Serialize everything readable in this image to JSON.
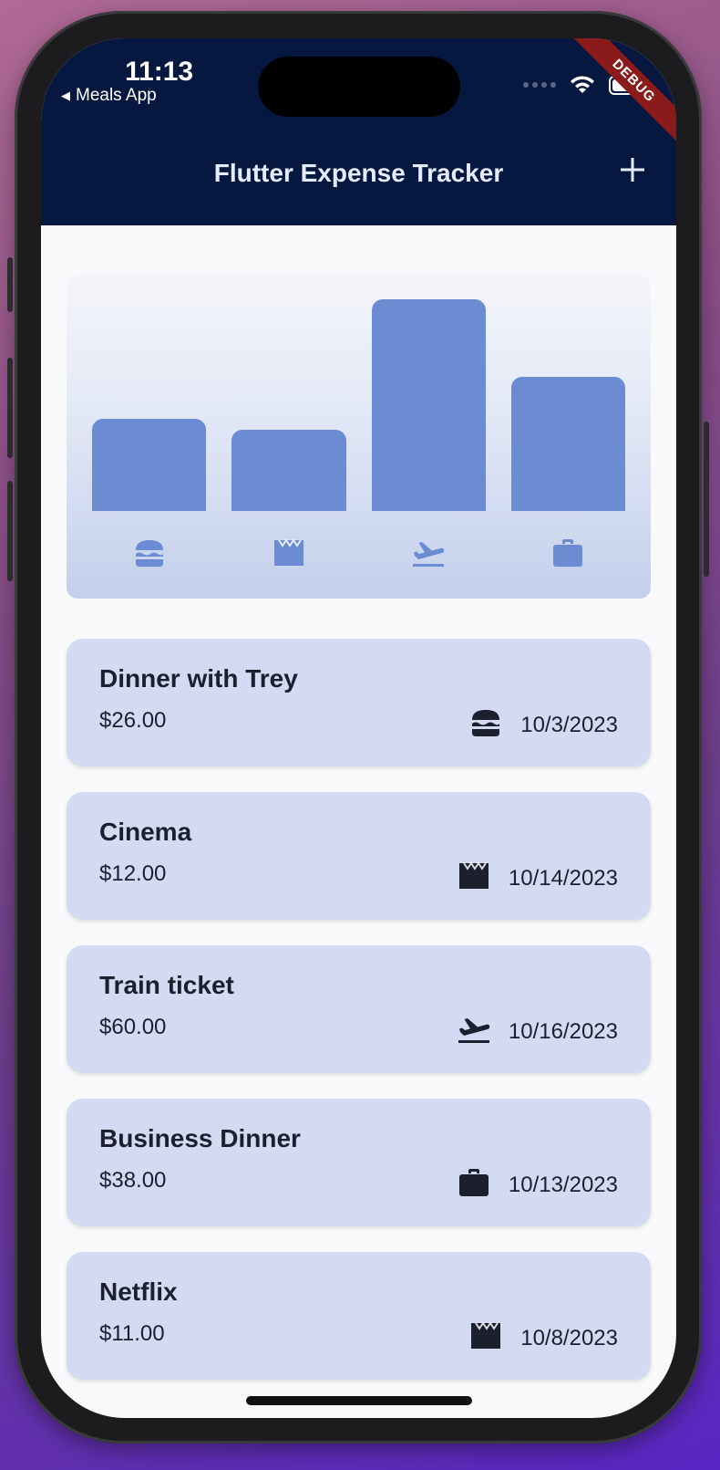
{
  "status_bar": {
    "time": "11:13",
    "back_app": "Meals App"
  },
  "debug_banner": "DEBUG",
  "app_bar": {
    "title": "Flutter Expense Tracker",
    "add_icon": "plus-icon"
  },
  "colors": {
    "app_bar": "#061840",
    "bar": "#6b8bd2",
    "card": "#d3dbf3",
    "category_icon_chart": "#6b8bd2"
  },
  "chart_data": {
    "type": "bar",
    "categories": [
      "food",
      "leisure",
      "travel",
      "work"
    ],
    "category_icons": [
      "burger-icon",
      "clapperboard-icon",
      "flight-takeoff-icon",
      "briefcase-icon"
    ],
    "values": [
      26,
      23,
      60,
      38
    ],
    "title": "",
    "xlabel": "",
    "ylabel": "",
    "grid": false
  },
  "expenses": [
    {
      "title": "Dinner with Trey",
      "amount": "$26.00",
      "icon": "burger-icon",
      "date": "10/3/2023"
    },
    {
      "title": "Cinema",
      "amount": "$12.00",
      "icon": "clapperboard-icon",
      "date": "10/14/2023"
    },
    {
      "title": "Train ticket",
      "amount": "$60.00",
      "icon": "flight-takeoff-icon",
      "date": "10/16/2023"
    },
    {
      "title": "Business Dinner",
      "amount": "$38.00",
      "icon": "briefcase-icon",
      "date": "10/13/2023"
    },
    {
      "title": "Netflix",
      "amount": "$11.00",
      "icon": "clapperboard-icon",
      "date": "10/8/2023"
    }
  ]
}
